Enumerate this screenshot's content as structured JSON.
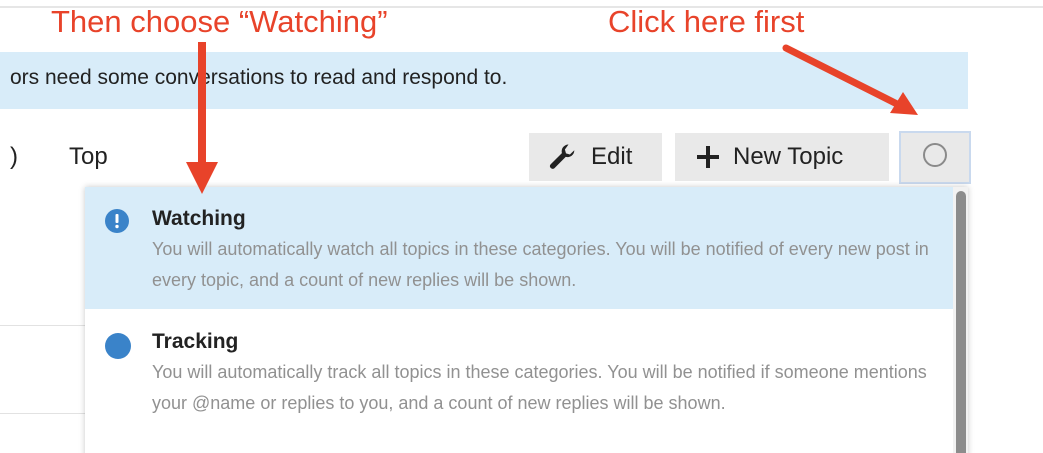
{
  "banner": {
    "text": "ors need some conversations to read and respond to."
  },
  "nav": {
    "paren": ")",
    "top_label": "Top"
  },
  "toolbar": {
    "edit_label": "Edit",
    "edit_icon": "wrench-icon",
    "new_topic_label": "New Topic",
    "new_topic_icon": "plus-icon",
    "notification_icon": "circle-outline-icon"
  },
  "notification_menu": {
    "options": [
      {
        "icon": "exclamation-circle-icon",
        "title": "Watching",
        "description": "You will automatically watch all topics in these categories. You will be notified of every new post in every topic, and a count of new replies will be shown.",
        "highlighted": true
      },
      {
        "icon": "filled-circle-icon",
        "title": "Tracking",
        "description": "You will automatically track all topics in these categories. You will be notified if someone mentions your @name or replies to you, and a count of new replies will be shown.",
        "highlighted": false
      }
    ]
  },
  "annotations": {
    "choose_text": "Then choose “Watching”",
    "click_text": "Click here first"
  },
  "colors": {
    "annotation": "#e8432a",
    "highlight": "#d8ecf9",
    "accent_blue": "#3a83c9",
    "button_bg": "#e9e9e9",
    "muted_text": "#919191"
  }
}
